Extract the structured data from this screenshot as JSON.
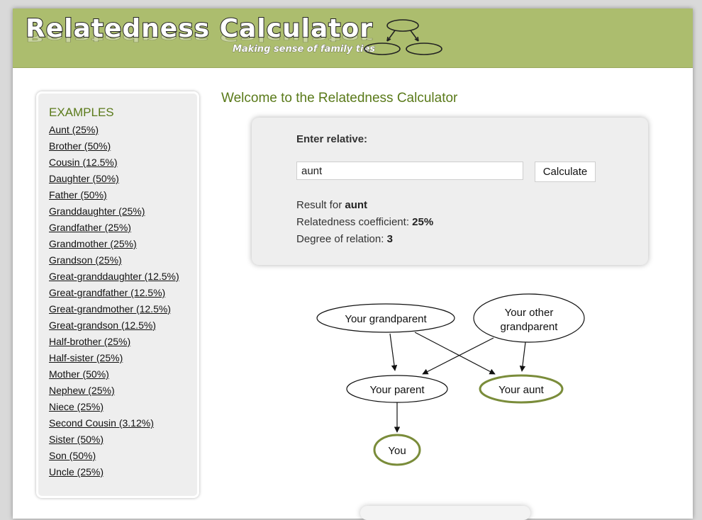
{
  "logo": {
    "title": "Relatedness Calculator",
    "tagline": "Making sense of family ties"
  },
  "sidebar": {
    "title": "EXAMPLES",
    "items": [
      "Aunt (25%)",
      "Brother (50%)",
      "Cousin (12.5%)",
      "Daughter (50%)",
      "Father (50%)",
      "Granddaughter (25%)",
      "Grandfather (25%)",
      "Grandmother (25%)",
      "Grandson (25%)",
      "Great-granddaughter (12.5%)",
      "Great-grandfather (12.5%)",
      "Great-grandmother (12.5%)",
      "Great-grandson (12.5%)",
      "Half-brother (25%)",
      "Half-sister (25%)",
      "Mother (50%)",
      "Nephew (25%)",
      "Niece (25%)",
      "Second Cousin (3.12%)",
      "Sister (50%)",
      "Son (50%)",
      "Uncle (25%)"
    ]
  },
  "main": {
    "welcome": "Welcome to the Relatedness Calculator",
    "form": {
      "label": "Enter relative:",
      "input_value": "aunt",
      "button_label": "Calculate"
    },
    "result": {
      "result_for_label": "Result for",
      "result_for_value": "aunt",
      "coefficient_label": "Relatedness coefficient:",
      "coefficient_value": "25%",
      "degree_label": "Degree of relation:",
      "degree_value": "3"
    }
  },
  "diagram": {
    "nodes": {
      "grandparent": "Your grandparent",
      "other_grandparent_line1": "Your other",
      "other_grandparent_line2": "grandparent",
      "parent": "Your parent",
      "aunt": "Your aunt",
      "you": "You"
    },
    "highlight_color": "#7a8c3a"
  },
  "colors": {
    "header": "#acbd6e",
    "accent_text": "#5a7a1a"
  }
}
